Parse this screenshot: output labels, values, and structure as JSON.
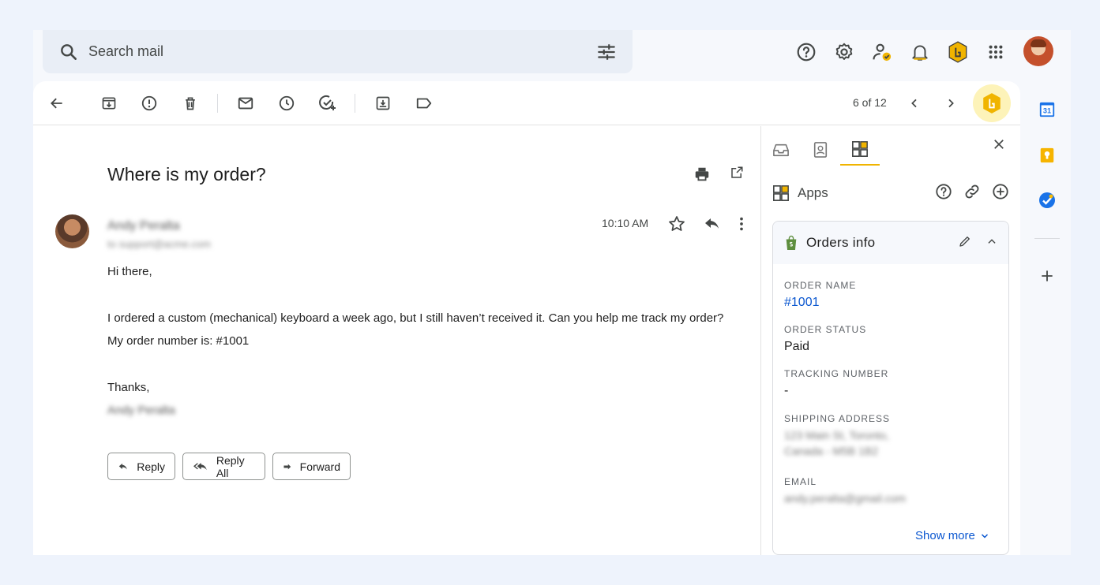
{
  "search": {
    "placeholder": "Search mail"
  },
  "toolbar": {
    "pager": "6 of 12"
  },
  "email": {
    "subject": "Where is my order?",
    "sender_name": "Andy Peralta",
    "sender_to": "to support@acme.com",
    "time": "10:10 AM",
    "greeting": "Hi there,",
    "line1": "I ordered a custom (mechanical) keyboard a week ago, but I still haven’t received it. Can you help me track my order?",
    "line2": "My order number is: #1001",
    "thanks": "Thanks,",
    "signature": "Andy Peralta"
  },
  "actions": {
    "reply": "Reply",
    "reply_all": "Reply All",
    "forward": "Forward"
  },
  "side": {
    "apps_label": "Apps",
    "card_title": "Orders info",
    "fields": {
      "order_name_label": "ORDER NAME",
      "order_name_value": "#1001",
      "order_status_label": "ORDER STATUS",
      "order_status_value": "Paid",
      "tracking_label": "TRACKING NUMBER",
      "tracking_value": "-",
      "address_label": "SHIPPING ADDRESS",
      "address_line1": "123 Main St, Toronto,",
      "address_line2": "Canada - M5B 1B2",
      "email_label": "EMAIL",
      "email_value": "andy.peralta@gmail.com"
    },
    "show_more": "Show more"
  },
  "rail": {
    "calendar_day": "31"
  },
  "colors": {
    "accent_yellow": "#f0b400",
    "link_blue": "#0b57d0",
    "hubspot_bg": "#fdf3b9"
  }
}
